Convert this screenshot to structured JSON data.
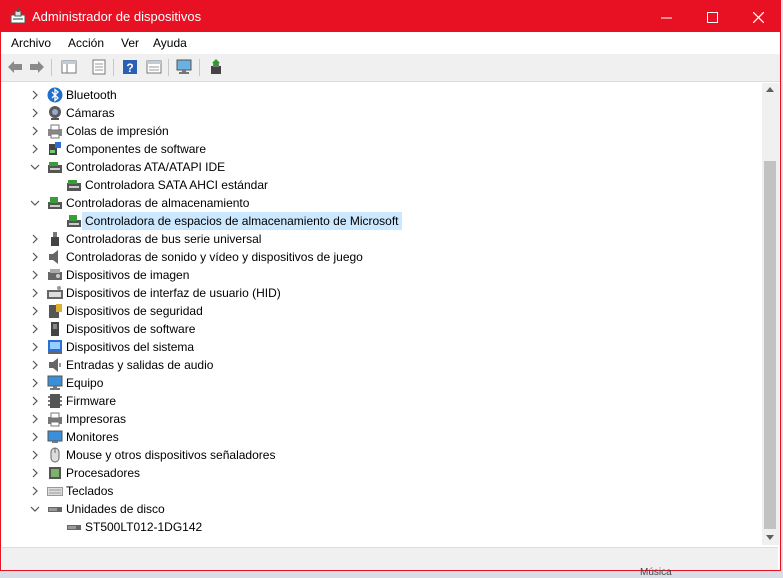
{
  "window": {
    "title": "Administrador de dispositivos",
    "accent": "#e81123"
  },
  "menu": [
    "Archivo",
    "Acción",
    "Ver",
    "Ayuda"
  ],
  "tree": [
    {
      "label": "Bluetooth",
      "icon": "bluetooth-icon",
      "expander": "collapsed",
      "level": 0
    },
    {
      "label": "Cámaras",
      "icon": "camera-icon",
      "expander": "collapsed",
      "level": 0
    },
    {
      "label": "Colas de impresión",
      "icon": "print-queue-icon",
      "expander": "collapsed",
      "level": 0
    },
    {
      "label": "Componentes de software",
      "icon": "software-component-icon",
      "expander": "collapsed",
      "level": 0
    },
    {
      "label": "Controladoras ATA/ATAPI IDE",
      "icon": "ide-controller-icon",
      "expander": "expanded",
      "level": 0
    },
    {
      "label": "Controladora SATA AHCI estándar",
      "icon": "ide-controller-icon",
      "expander": "none",
      "level": 1
    },
    {
      "label": "Controladoras de almacenamiento",
      "icon": "storage-controller-icon",
      "expander": "expanded",
      "level": 0
    },
    {
      "label": "Controladora de espacios de almacenamiento de Microsoft",
      "icon": "storage-controller-icon",
      "expander": "none",
      "level": 1,
      "selected": true
    },
    {
      "label": "Controladoras de bus serie universal",
      "icon": "usb-icon",
      "expander": "collapsed",
      "level": 0
    },
    {
      "label": "Controladoras de sonido y vídeo y dispositivos de juego",
      "icon": "speaker-icon",
      "expander": "collapsed",
      "level": 0
    },
    {
      "label": "Dispositivos de imagen",
      "icon": "imaging-device-icon",
      "expander": "collapsed",
      "level": 0
    },
    {
      "label": "Dispositivos de interfaz de usuario (HID)",
      "icon": "hid-icon",
      "expander": "collapsed",
      "level": 0
    },
    {
      "label": "Dispositivos de seguridad",
      "icon": "security-device-icon",
      "expander": "collapsed",
      "level": 0
    },
    {
      "label": "Dispositivos de software",
      "icon": "software-device-icon",
      "expander": "collapsed",
      "level": 0
    },
    {
      "label": "Dispositivos del sistema",
      "icon": "system-device-icon",
      "expander": "collapsed",
      "level": 0
    },
    {
      "label": "Entradas y salidas de audio",
      "icon": "audio-io-icon",
      "expander": "collapsed",
      "level": 0
    },
    {
      "label": "Equipo",
      "icon": "computer-icon",
      "expander": "collapsed",
      "level": 0
    },
    {
      "label": "Firmware",
      "icon": "firmware-icon",
      "expander": "collapsed",
      "level": 0
    },
    {
      "label": "Impresoras",
      "icon": "printer-icon",
      "expander": "collapsed",
      "level": 0
    },
    {
      "label": "Monitores",
      "icon": "monitor-icon",
      "expander": "collapsed",
      "level": 0
    },
    {
      "label": "Mouse y otros dispositivos señaladores",
      "icon": "mouse-icon",
      "expander": "collapsed",
      "level": 0
    },
    {
      "label": "Procesadores",
      "icon": "processor-icon",
      "expander": "collapsed",
      "level": 0
    },
    {
      "label": "Teclados",
      "icon": "keyboard-icon",
      "expander": "collapsed",
      "level": 0
    },
    {
      "label": "Unidades de disco",
      "icon": "disk-drive-icon",
      "expander": "expanded",
      "level": 0
    },
    {
      "label": "ST500LT012-1DG142",
      "icon": "disk-drive-icon",
      "expander": "none",
      "level": 1
    }
  ],
  "background_text": "Música"
}
